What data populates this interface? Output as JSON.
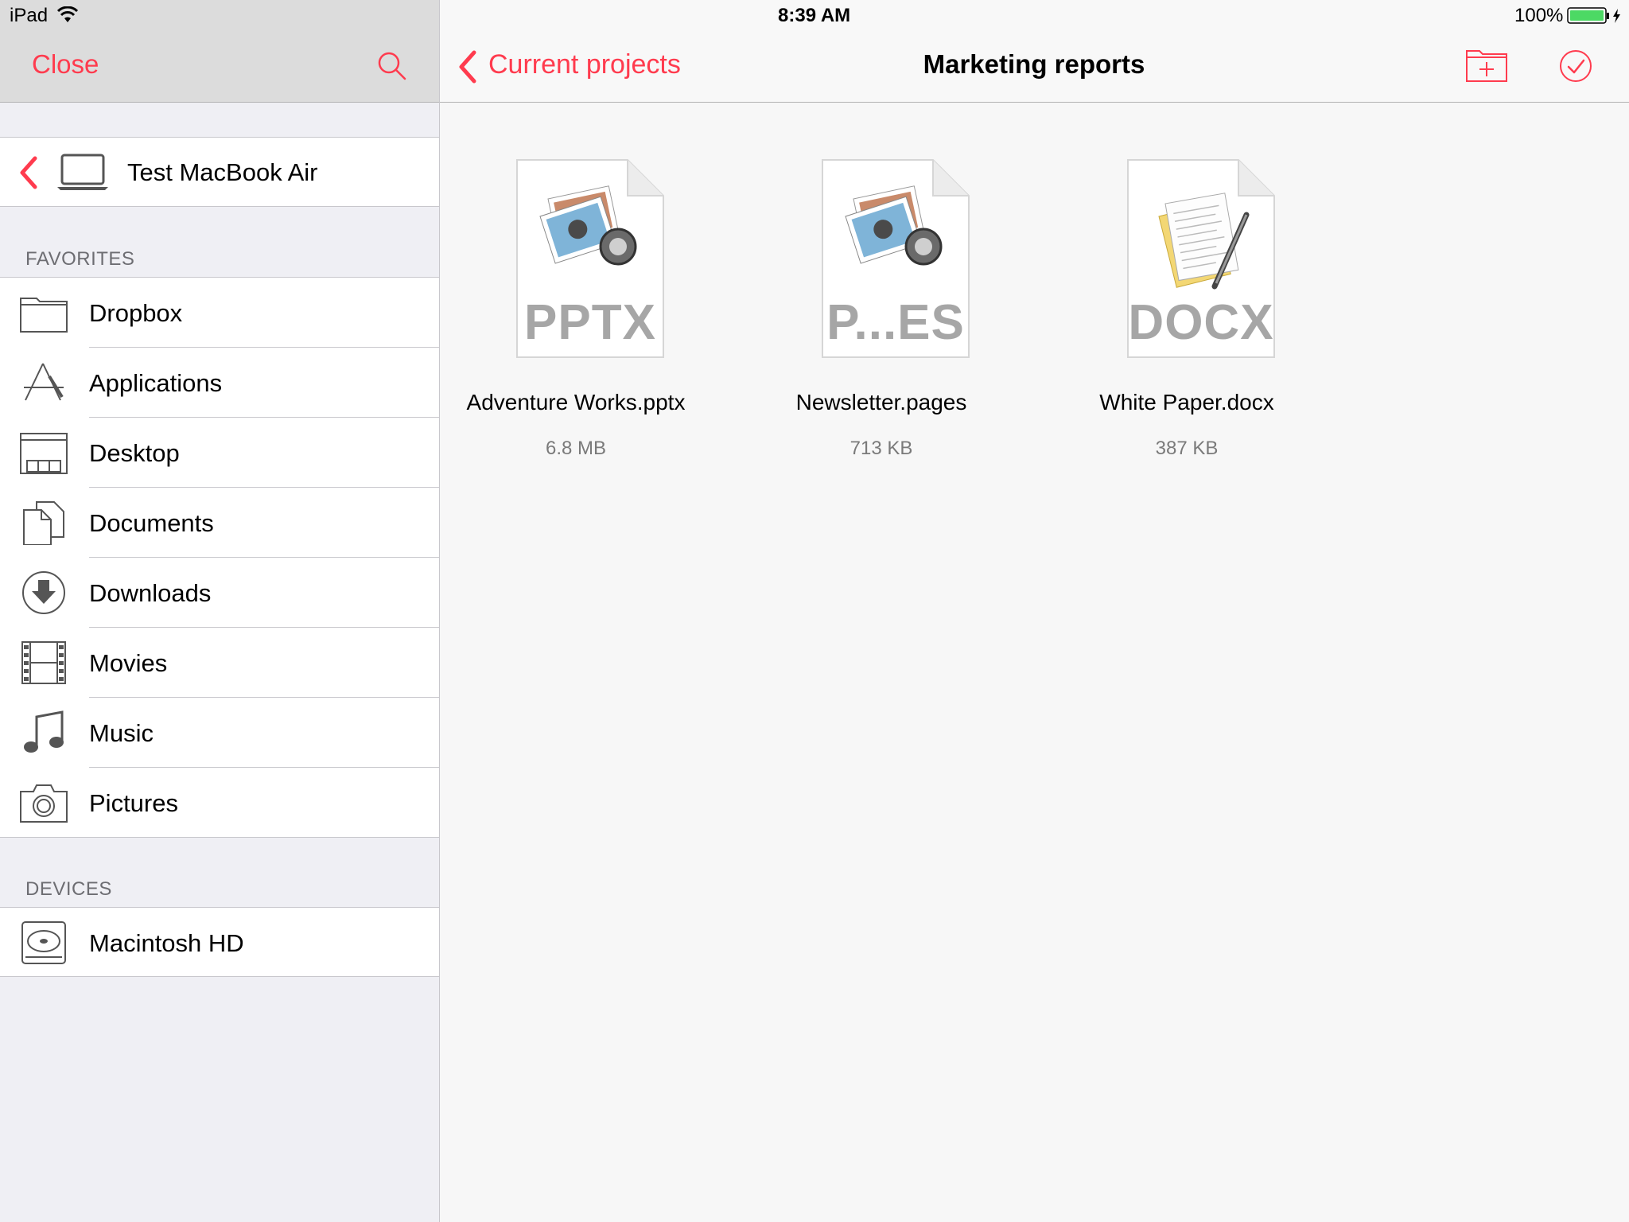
{
  "status_bar": {
    "device": "iPad",
    "time": "8:39 AM",
    "battery": "100%"
  },
  "sidebar": {
    "close_label": "Close",
    "computer_name": "Test MacBook Air",
    "favorites_title": "FAVORITES",
    "favorites": [
      {
        "label": "Dropbox",
        "icon": "folder-icon"
      },
      {
        "label": "Applications",
        "icon": "applications-icon"
      },
      {
        "label": "Desktop",
        "icon": "desktop-icon"
      },
      {
        "label": "Documents",
        "icon": "documents-icon"
      },
      {
        "label": "Downloads",
        "icon": "downloads-icon"
      },
      {
        "label": "Movies",
        "icon": "film-icon"
      },
      {
        "label": "Music",
        "icon": "music-note-icon"
      },
      {
        "label": "Pictures",
        "icon": "camera-icon"
      }
    ],
    "devices_title": "DEVICES",
    "devices": [
      {
        "label": "Macintosh HD",
        "icon": "hard-drive-icon"
      }
    ]
  },
  "nav": {
    "back_label": "Current projects",
    "title": "Marketing reports"
  },
  "files": [
    {
      "name": "Adventure Works.pptx",
      "size": "6.8 MB",
      "ext": "PPTX",
      "icon": "keynote-document-icon"
    },
    {
      "name": "Newsletter.pages",
      "size": "713 KB",
      "ext": "P...ES",
      "icon": "keynote-document-icon"
    },
    {
      "name": "White Paper.docx",
      "size": "387 KB",
      "ext": "DOCX",
      "icon": "text-document-icon"
    }
  ],
  "colors": {
    "accent": "#ff3b4e",
    "battery": "#4cd964"
  }
}
